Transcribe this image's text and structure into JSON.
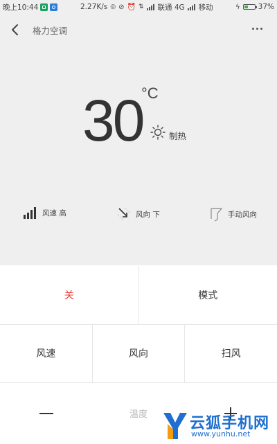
{
  "status_bar": {
    "time": "晚上10:44",
    "speed": "2.27K/s",
    "carrier1": "联通 4G",
    "carrier2": "移动",
    "battery": "37%"
  },
  "header": {
    "title": "格力空调"
  },
  "display": {
    "temperature": "30",
    "unit": "°C",
    "mode": "制热"
  },
  "controls": {
    "fan_speed": "风速 高",
    "wind_direction": "风向 下",
    "manual_direction": "手动风向"
  },
  "buttons": {
    "off": "关",
    "mode": "模式",
    "fan_speed": "风速",
    "wind_direction": "风向",
    "sweep": "扫风",
    "temperature": "温度"
  },
  "watermark": {
    "name": "云狐手机网",
    "url": "www.yunhu.net"
  },
  "colors": {
    "off_text": "#e8413c",
    "panel_bg": "#efefef",
    "watermark": "#1e6fd0"
  }
}
